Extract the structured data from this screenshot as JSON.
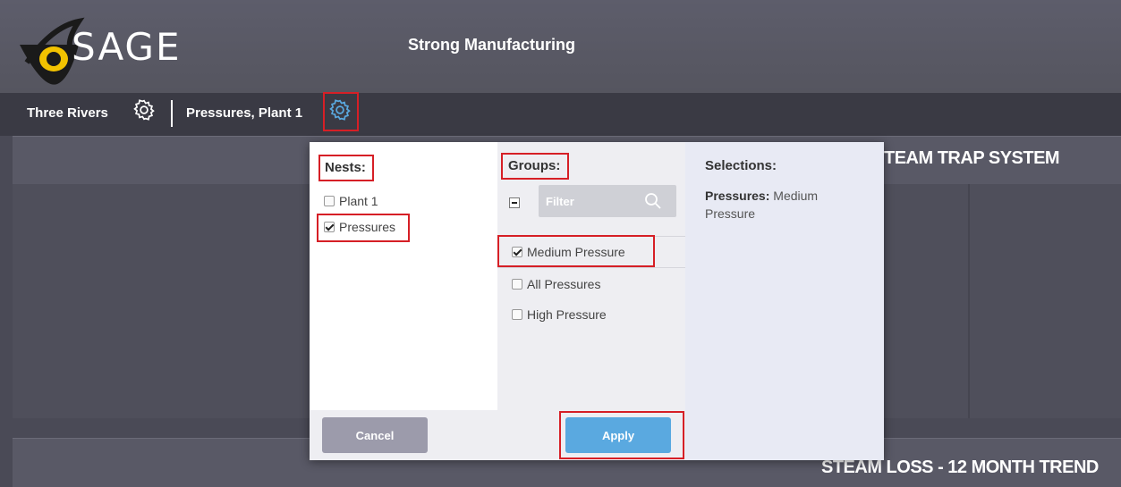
{
  "header": {
    "logo_text": "SAGE",
    "company": "Strong Manufacturing"
  },
  "breadcrumb": {
    "items": [
      {
        "label": "Three Rivers"
      },
      {
        "label": "Pressures, Plant 1"
      }
    ]
  },
  "background": {
    "panel_title_1": "TEAM TRAP SYSTEM",
    "panel_title_2": "STEAM LOSS - 12 MONTH TREND"
  },
  "modal": {
    "nests": {
      "title": "Nests:",
      "items": [
        {
          "label": "Plant 1",
          "checked": false
        },
        {
          "label": "Pressures",
          "checked": true
        }
      ]
    },
    "groups": {
      "title": "Groups:",
      "filter_placeholder": "Filter",
      "items": [
        {
          "label": "Medium Pressure",
          "checked": true
        },
        {
          "label": "All Pressures",
          "checked": false
        },
        {
          "label": "High Pressure",
          "checked": false
        }
      ]
    },
    "selections": {
      "title": "Selections:",
      "key": "Pressures:",
      "value": " Medium Pressure"
    },
    "cancel_label": "Cancel",
    "apply_label": "Apply"
  },
  "colors": {
    "highlight": "#d61f26",
    "apply": "#5aa9e0",
    "cancel": "#9c9bab",
    "logo_eye": "#f2c200"
  }
}
